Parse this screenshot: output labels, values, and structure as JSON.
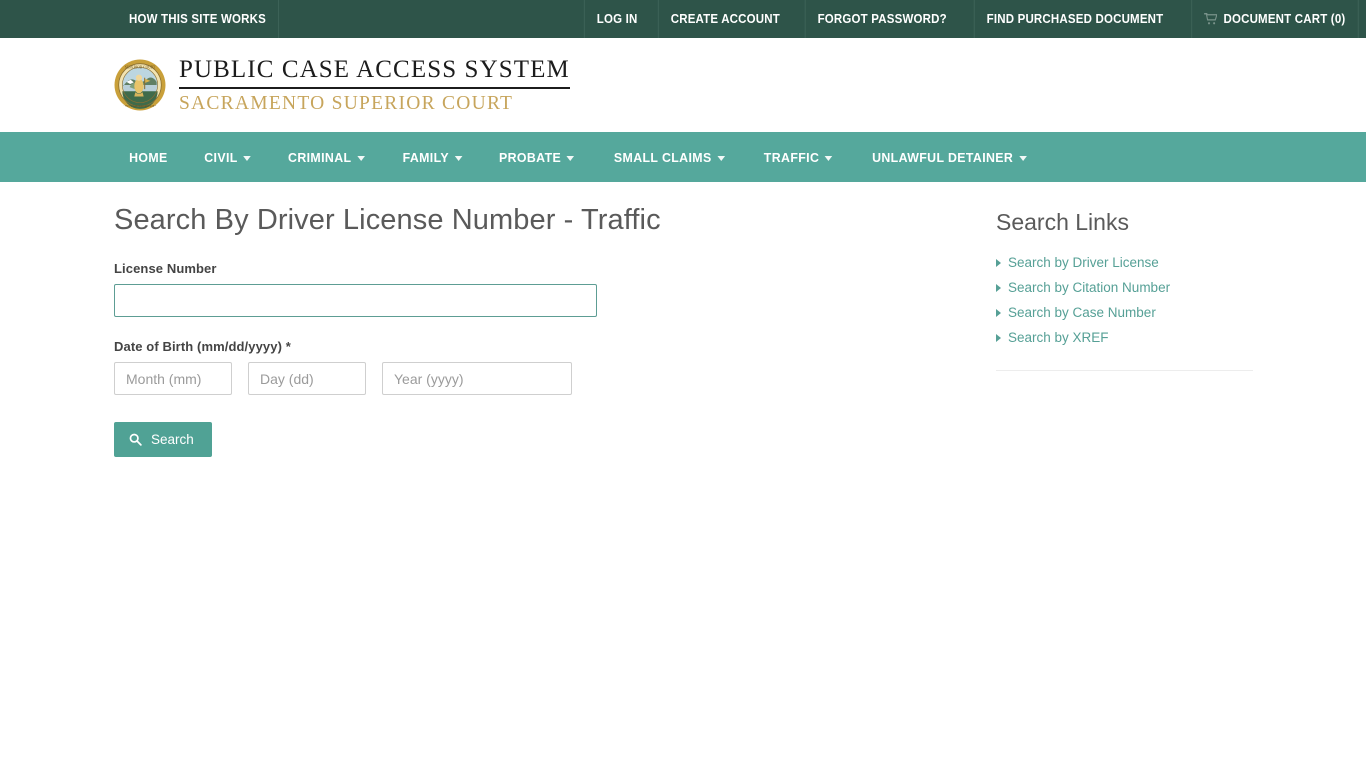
{
  "topbar": {
    "background": "#2e5449",
    "links": [
      {
        "label": "HOW THIS SITE WORKS",
        "icon": null
      },
      {
        "label": "LOG IN",
        "icon": null
      },
      {
        "label": "CREATE ACCOUNT",
        "icon": null
      },
      {
        "label": "FORGOT PASSWORD?",
        "icon": null
      },
      {
        "label": "FIND PURCHASED DOCUMENT",
        "icon": null
      },
      {
        "label": "DOCUMENT CART (0)",
        "icon": "shopping-cart-icon"
      }
    ]
  },
  "masthead": {
    "seal_alt": "sacramento-superior-court-seal",
    "title": "PUBLIC CASE ACCESS SYSTEM",
    "subtitle": "SACRAMENTO SUPERIOR COURT",
    "subtitle_color": "#c7a55c"
  },
  "nav": {
    "background": "#55a89c",
    "items": [
      {
        "label": "HOME",
        "has_caret": false
      },
      {
        "label": "CIVIL",
        "has_caret": true
      },
      {
        "label": "CRIMINAL",
        "has_caret": true
      },
      {
        "label": "FAMILY",
        "has_caret": true
      },
      {
        "label": "PROBATE",
        "has_caret": true
      },
      {
        "label": "SMALL CLAIMS",
        "has_caret": true
      },
      {
        "label": "TRAFFIC",
        "has_caret": true
      },
      {
        "label": "UNLAWFUL DETAINER",
        "has_caret": true
      }
    ]
  },
  "main": {
    "page_title": "Search By Driver License Number - Traffic",
    "license_field": {
      "label": "License Number",
      "value": "",
      "placeholder": ""
    },
    "dob": {
      "label": "Date of Birth (mm/dd/yyyy) *",
      "month": {
        "placeholder": "Month (mm)",
        "value": ""
      },
      "day": {
        "placeholder": "Day (dd)",
        "value": ""
      },
      "year": {
        "placeholder": "Year (yyyy)",
        "value": ""
      }
    },
    "search_button": {
      "label": "Search",
      "icon": "search-icon",
      "color": "#50a295"
    }
  },
  "sidebar": {
    "title": "Search Links",
    "links": [
      {
        "label": "Search by Driver License"
      },
      {
        "label": "Search by Citation Number"
      },
      {
        "label": "Search by Case Number"
      },
      {
        "label": "Search by XREF"
      }
    ],
    "link_color": "#56a096"
  }
}
